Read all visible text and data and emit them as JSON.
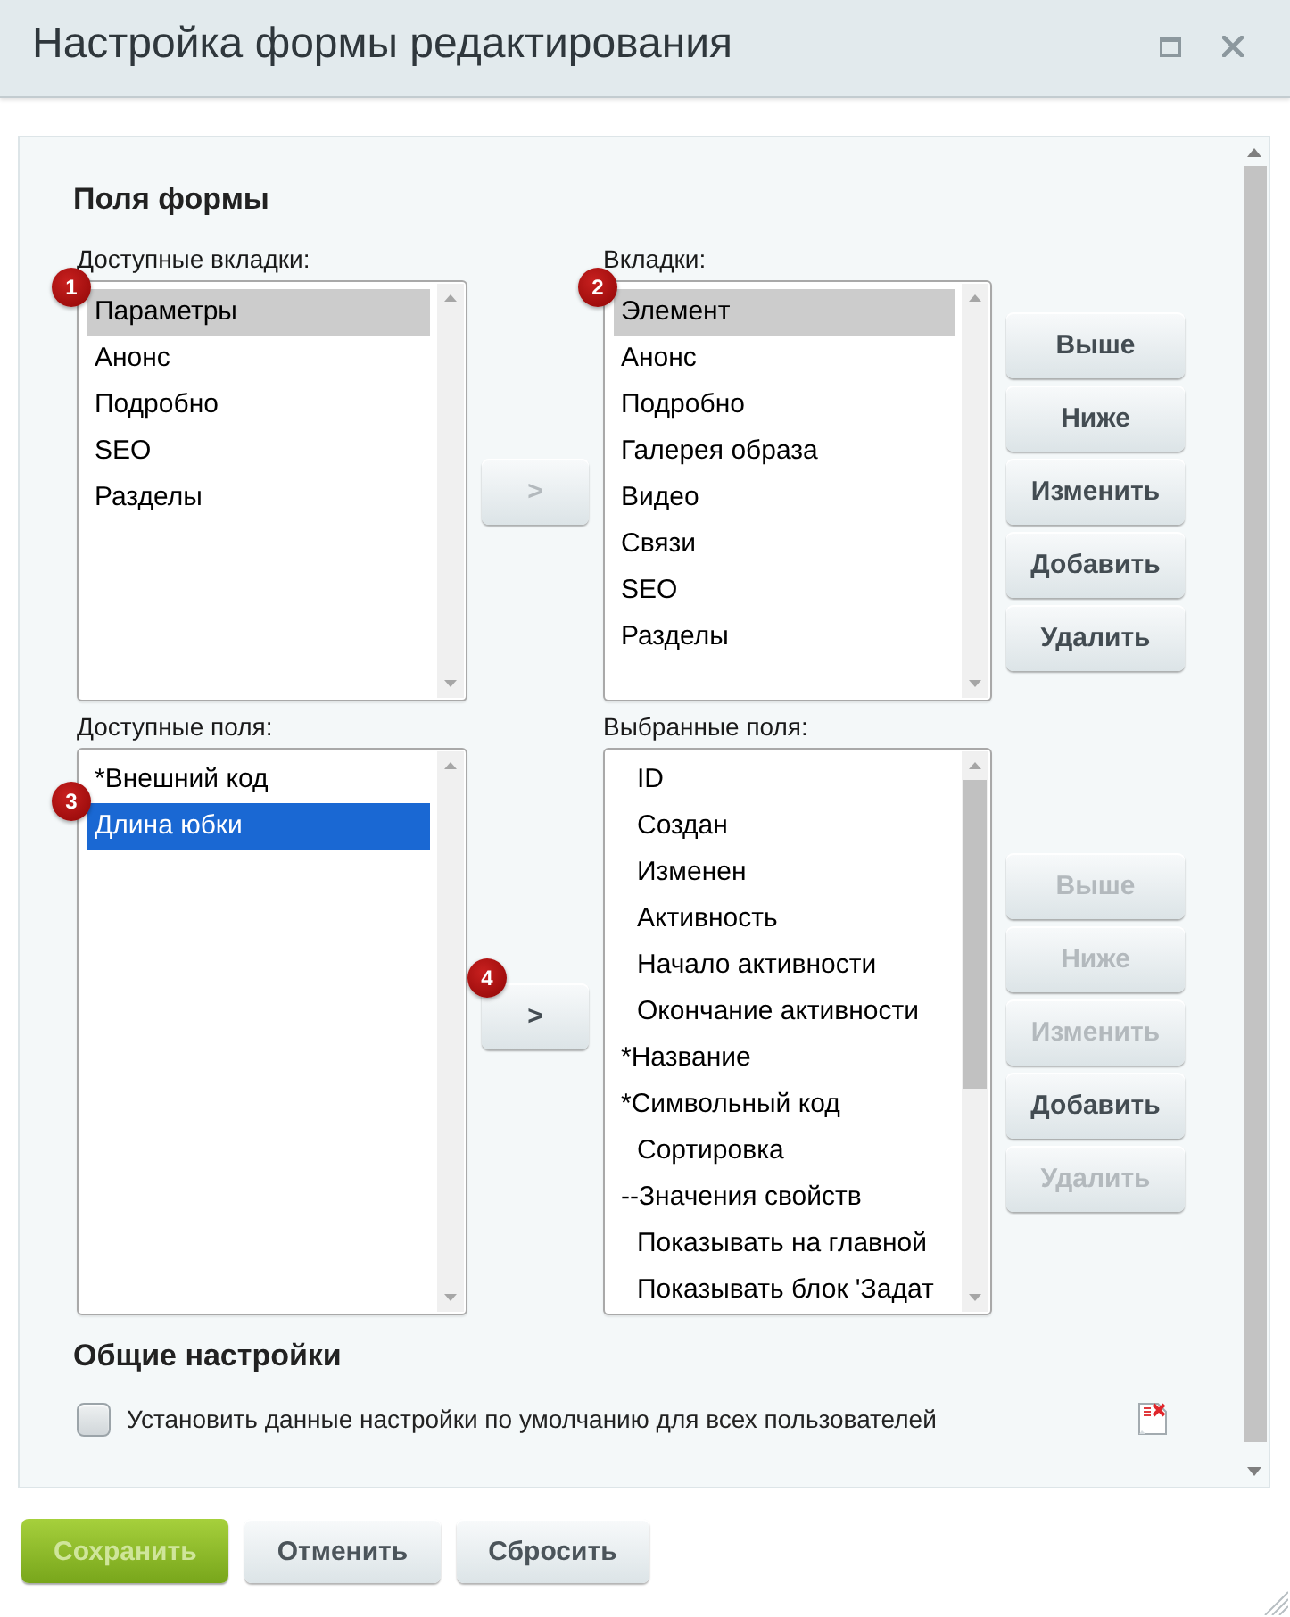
{
  "window": {
    "title": "Настройка формы редактирования"
  },
  "form_fields": {
    "heading": "Поля формы",
    "rows": [
      {
        "available": {
          "label": "Доступные вкладки:",
          "focused": false,
          "items": [
            {
              "text": "Параметры",
              "selected": true,
              "badge": "1"
            },
            {
              "text": "Анонс",
              "selected": false
            },
            {
              "text": "Подробно",
              "selected": false
            },
            {
              "text": "SEO",
              "selected": false
            },
            {
              "text": "Разделы",
              "selected": false
            }
          ]
        },
        "move_button": {
          "label": ">",
          "disabled": true
        },
        "chosen": {
          "label": "Вкладки:",
          "focused": false,
          "items": [
            {
              "text": "Элемент",
              "selected": true,
              "badge": "2"
            },
            {
              "text": "Анонс",
              "selected": false
            },
            {
              "text": "Подробно",
              "selected": false
            },
            {
              "text": "Галерея образа",
              "selected": false
            },
            {
              "text": "Видео",
              "selected": false
            },
            {
              "text": "Связи",
              "selected": false
            },
            {
              "text": "SEO",
              "selected": false
            },
            {
              "text": "Разделы",
              "selected": false
            }
          ]
        },
        "actions": [
          {
            "label": "Выше",
            "disabled": false
          },
          {
            "label": "Ниже",
            "disabled": false
          },
          {
            "label": "Изменить",
            "disabled": false
          },
          {
            "label": "Добавить",
            "disabled": false
          },
          {
            "label": "Удалить",
            "disabled": false
          }
        ]
      },
      {
        "available": {
          "label": "Доступные поля:",
          "focused": true,
          "items": [
            {
              "text": "*Внешний код",
              "selected": false
            },
            {
              "text": "Длина юбки",
              "selected": true,
              "badge": "3"
            }
          ]
        },
        "move_button": {
          "label": ">",
          "disabled": false,
          "badge": "4"
        },
        "chosen": {
          "label": "Выбранные поля:",
          "items": [
            {
              "text": "ID",
              "selected": false,
              "indented": true
            },
            {
              "text": "Создан",
              "selected": false,
              "indented": true
            },
            {
              "text": "Изменен",
              "selected": false,
              "indented": true
            },
            {
              "text": "Активность",
              "selected": false,
              "indented": true
            },
            {
              "text": "Начало активности",
              "selected": false,
              "indented": true
            },
            {
              "text": "Окончание активности",
              "selected": false,
              "indented": true
            },
            {
              "text": "*Название",
              "selected": false,
              "indented": false
            },
            {
              "text": "*Символьный код",
              "selected": false,
              "indented": false
            },
            {
              "text": "Сортировка",
              "selected": false,
              "indented": true
            },
            {
              "text": "--Значения свойств",
              "selected": false,
              "indented": false
            },
            {
              "text": "Показывать на главной",
              "selected": false,
              "indented": true
            },
            {
              "text": "Показывать блок 'Задат",
              "selected": false,
              "indented": true
            }
          ]
        },
        "actions": [
          {
            "label": "Выше",
            "disabled": true
          },
          {
            "label": "Ниже",
            "disabled": true
          },
          {
            "label": "Изменить",
            "disabled": true
          },
          {
            "label": "Добавить",
            "disabled": false
          },
          {
            "label": "Удалить",
            "disabled": true
          }
        ]
      }
    ]
  },
  "general": {
    "heading": "Общие настройки",
    "checkbox": {
      "label": "Установить данные настройки по умолчанию для всех пользователей",
      "checked": false
    }
  },
  "footer_buttons": [
    {
      "label": "Сохранить",
      "kind": "primary",
      "disabled": true
    },
    {
      "label": "Отменить",
      "kind": "default",
      "disabled": false
    },
    {
      "label": "Сбросить",
      "kind": "default",
      "disabled": false
    }
  ]
}
